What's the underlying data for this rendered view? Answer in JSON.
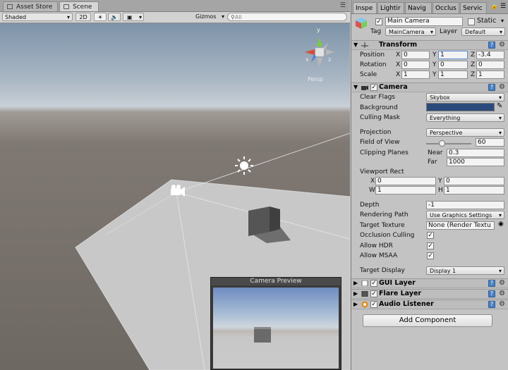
{
  "left_tabs": [
    {
      "label": "Asset Store",
      "active": false
    },
    {
      "label": "Scene",
      "active": true
    }
  ],
  "scene_toolbar": {
    "shading_mode": "Shaded",
    "mode_2d": "2D",
    "gizmos": "Gizmos",
    "search_placeholder": "All"
  },
  "scene": {
    "persp_label": "Persp",
    "axis_labels": {
      "y": "y",
      "x": "x",
      "z": "z"
    },
    "camera_preview_title": "Camera Preview"
  },
  "inspector": {
    "tabs": [
      "Inspe",
      "Lightir",
      "Navig",
      "Occlus",
      "Servic"
    ],
    "object": {
      "name": "Main Camera",
      "static_label": "Static",
      "tag_label": "Tag",
      "tag_value": "MainCamera",
      "layer_label": "Layer",
      "layer_value": "Default"
    },
    "transform": {
      "title": "Transform",
      "rows": [
        {
          "label": "Position",
          "x": "0",
          "y": "1",
          "z": "-3.4"
        },
        {
          "label": "Rotation",
          "x": "0",
          "y": "0",
          "z": "0"
        },
        {
          "label": "Scale",
          "x": "1",
          "y": "1",
          "z": "1"
        }
      ],
      "axis": {
        "x": "X",
        "y": "Y",
        "z": "Z"
      }
    },
    "camera": {
      "title": "Camera",
      "clear_flags_label": "Clear Flags",
      "clear_flags": "Skybox",
      "background_label": "Background",
      "background_color": "#2b4a7c",
      "culling_mask_label": "Culling Mask",
      "culling_mask": "Everything",
      "projection_label": "Projection",
      "projection": "Perspective",
      "fov_label": "Field of View",
      "fov": "60",
      "fov_fraction": 0.33,
      "clipping_label": "Clipping Planes",
      "near_label": "Near",
      "near": "0.3",
      "far_label": "Far",
      "far": "1000",
      "viewport_label": "Viewport Rect",
      "vp_x_label": "X",
      "vp_x": "0",
      "vp_y_label": "Y",
      "vp_y": "0",
      "vp_w_label": "W",
      "vp_w": "1",
      "vp_h_label": "H",
      "vp_h": "1",
      "depth_label": "Depth",
      "depth": "-1",
      "rendering_path_label": "Rendering Path",
      "rendering_path": "Use Graphics Settings",
      "target_texture_label": "Target Texture",
      "target_texture": "None (Render Textu",
      "occlusion_label": "Occlusion Culling",
      "hdr_label": "Allow HDR",
      "msaa_label": "Allow MSAA",
      "target_display_label": "Target Display",
      "target_display": "Display 1"
    },
    "components": [
      {
        "name": "GUI Layer"
      },
      {
        "name": "Flare Layer"
      },
      {
        "name": "Audio Listener"
      }
    ],
    "add_component": "Add Component"
  }
}
